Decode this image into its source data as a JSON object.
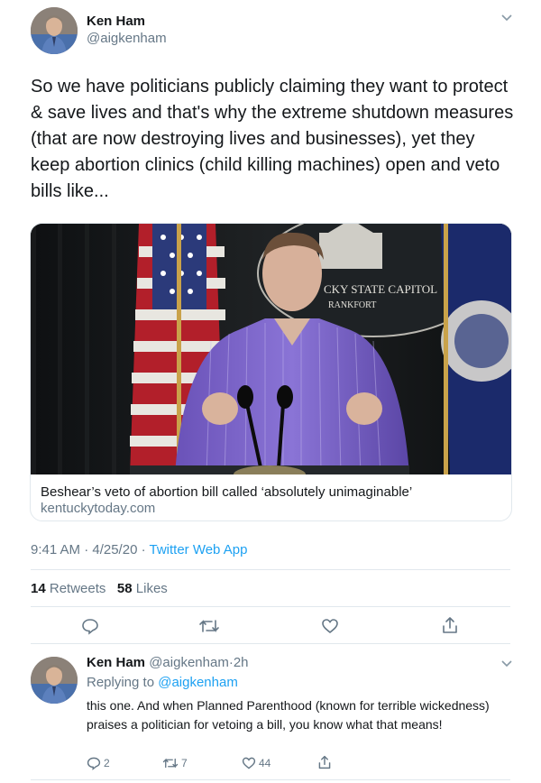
{
  "tweet": {
    "author_name": "Ken Ham",
    "author_handle": "@aigkenham",
    "text": "So we have politicians publicly claiming they want to protect & save lives and that's why the extreme shutdown measures (that are now destroying lives and businesses), yet they keep abortion clinics (child killing machines) open and veto bills like...",
    "card": {
      "image_sign_text_1": "CKY STATE CAPITOL",
      "image_sign_text_2": "RANKFORT",
      "title": "Beshear’s veto of abortion bill called ‘absolutely unimaginable’",
      "domain": "kentuckytoday.com"
    },
    "time": "9:41 AM · 4/25/20 · ",
    "source": "Twitter Web App",
    "retweets_count": "14",
    "retweets_label": "Retweets",
    "likes_count": "58",
    "likes_label": "Likes"
  },
  "reply": {
    "author_name": "Ken Ham",
    "author_handle": "@aigkenham",
    "time_sep": "·",
    "time": "2h",
    "replying_to_label": "Replying to",
    "replying_to_handle": "@aigkenham",
    "text": "this one.  And when Planned Parenthood (known for terrible wickedness) praises a politician for vetoing a bill, you know what that means!",
    "reply_count": "2",
    "retweet_count": "7",
    "like_count": "44"
  },
  "icons": [
    "chevron-down-icon",
    "reply-icon",
    "retweet-icon",
    "like-icon",
    "share-icon"
  ],
  "colors": {
    "link": "#1da1f2",
    "secondary_text": "#657786",
    "divider": "#e1e8ed"
  }
}
